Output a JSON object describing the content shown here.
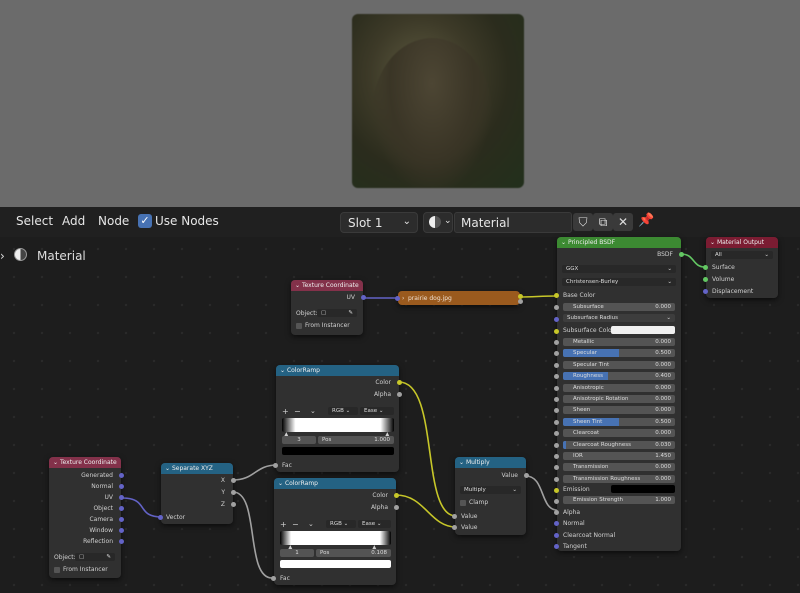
{
  "toolbar": {
    "select": "Select",
    "add": "Add",
    "node": "Node",
    "use_nodes": "Use Nodes",
    "slot": "Slot 1",
    "material": "Material"
  },
  "breadcrumb": {
    "label": "Material"
  },
  "nodes": {
    "texcoord_top": {
      "title": "Texture Coordinate",
      "uv": "UV",
      "object": "Object:",
      "from_instancer": "From Instancer"
    },
    "image": {
      "title": "prairie dog.jpg"
    },
    "colorramp1": {
      "title": "ColorRamp",
      "color": "Color",
      "alpha": "Alpha",
      "rgb": "RGB",
      "ease": "Ease",
      "index": "3",
      "pos_label": "Pos",
      "pos": "1.000",
      "fac": "Fac"
    },
    "colorramp2": {
      "title": "ColorRamp",
      "color": "Color",
      "alpha": "Alpha",
      "rgb": "RGB",
      "ease": "Ease",
      "index": "1",
      "pos_label": "Pos",
      "pos": "0.108",
      "fac": "Fac"
    },
    "texcoord_main": {
      "title": "Texture Coordinate",
      "outputs": [
        "Generated",
        "Normal",
        "UV",
        "Object",
        "Camera",
        "Window",
        "Reflection"
      ],
      "object": "Object:",
      "from_instancer": "From Instancer"
    },
    "separate": {
      "title": "Separate XYZ",
      "x": "X",
      "y": "Y",
      "z": "Z",
      "vector": "Vector"
    },
    "multiply": {
      "title": "Multiply",
      "value_out": "Value",
      "mode": "Multiply",
      "clamp": "Clamp",
      "in1": "Value",
      "in2": "Value"
    },
    "bsdf": {
      "title": "Principled BSDF",
      "bsdf": "BSDF",
      "dist": "GGX",
      "sss": "Christensen-Burley",
      "base_color": "Base Color",
      "subsurface": "Subsurface",
      "subsurface_val": "0.000",
      "subsurface_radius": "Subsurface Radius",
      "subsurface_color": "Subsurface Color",
      "rows": [
        {
          "label": "Metallic",
          "value": "0.000",
          "fill": 0
        },
        {
          "label": "Specular",
          "value": "0.500",
          "fill": 0.5
        },
        {
          "label": "Specular Tint",
          "value": "0.000",
          "fill": 0
        },
        {
          "label": "Roughness",
          "value": "0.400",
          "fill": 0.4
        },
        {
          "label": "Anisotropic",
          "value": "0.000",
          "fill": 0
        },
        {
          "label": "Anisotropic Rotation",
          "value": "0.000",
          "fill": 0
        },
        {
          "label": "Sheen",
          "value": "0.000",
          "fill": 0
        },
        {
          "label": "Sheen Tint",
          "value": "0.500",
          "fill": 0.5
        },
        {
          "label": "Clearcoat",
          "value": "0.000",
          "fill": 0
        },
        {
          "label": "Clearcoat Roughness",
          "value": "0.030",
          "fill": 0.03
        },
        {
          "label": "IOR",
          "value": "1.450",
          "fill": 0
        },
        {
          "label": "Transmission",
          "value": "0.000",
          "fill": 0
        },
        {
          "label": "Transmission Roughness",
          "value": "0.000",
          "fill": 0
        }
      ],
      "emission": "Emission",
      "emission_strength": "Emission Strength",
      "emission_strength_val": "1.000",
      "alpha": "Alpha",
      "normal": "Normal",
      "clearcoat_normal": "Clearcoat Normal",
      "tangent": "Tangent"
    },
    "output": {
      "title": "Material Output",
      "target": "All",
      "surface": "Surface",
      "volume": "Volume",
      "displacement": "Displacement"
    }
  }
}
